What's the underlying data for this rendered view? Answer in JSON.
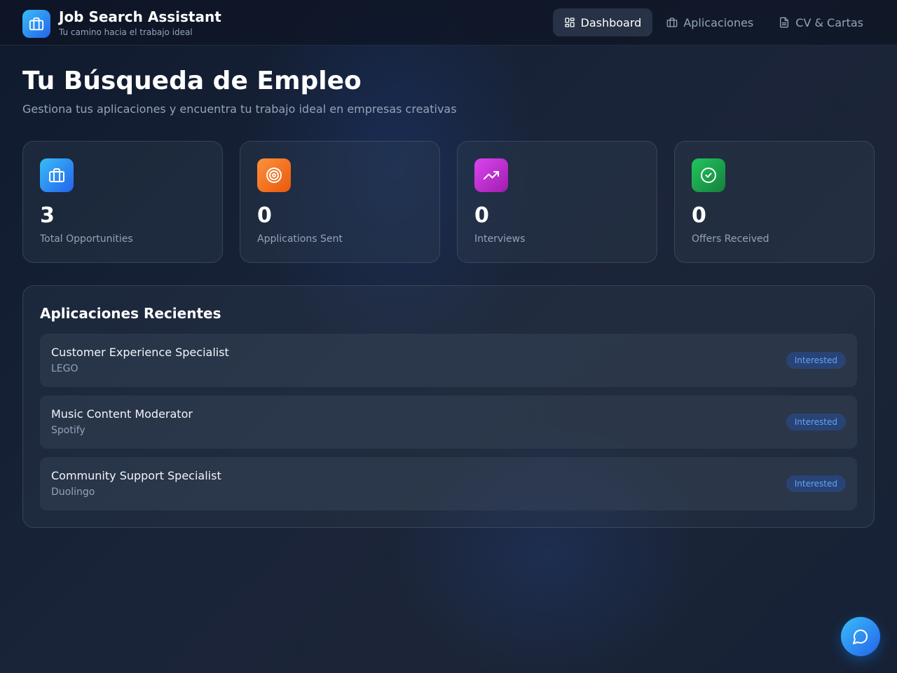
{
  "app": {
    "title": "Job Search Assistant",
    "subtitle": "Tu camino hacia el trabajo ideal",
    "logo_icon": "briefcase-icon"
  },
  "nav": {
    "items": [
      {
        "label": "Dashboard",
        "icon": "dashboard-grid-icon",
        "active": true
      },
      {
        "label": "Aplicaciones",
        "icon": "briefcase-icon",
        "active": false
      },
      {
        "label": "CV & Cartas",
        "icon": "document-icon",
        "active": false
      }
    ]
  },
  "header": {
    "title": "Tu Búsqueda de Empleo",
    "subtitle": "Gestiona tus aplicaciones y encuentra tu trabajo ideal en empresas creativas"
  },
  "stats": [
    {
      "value": "3",
      "label": "Total Opportunities",
      "icon": "briefcase-icon",
      "color": "#0ea5e9"
    },
    {
      "value": "0",
      "label": "Applications Sent",
      "icon": "target-icon",
      "color": "#f97316"
    },
    {
      "value": "0",
      "label": "Interviews",
      "icon": "trending-up-icon",
      "color": "#c026d3"
    },
    {
      "value": "0",
      "label": "Offers Received",
      "icon": "check-circle-icon",
      "color": "#16a34a"
    }
  ],
  "recent": {
    "title": "Aplicaciones Recientes",
    "items": [
      {
        "role": "Customer Experience Specialist",
        "company": "LEGO",
        "status": "Interested"
      },
      {
        "role": "Music Content Moderator",
        "company": "Spotify",
        "status": "Interested"
      },
      {
        "role": "Community Support Specialist",
        "company": "Duolingo",
        "status": "Interested"
      }
    ]
  },
  "chat": {
    "icon": "chat-bubble-icon"
  },
  "colors": {
    "accent": "#2563eb",
    "badge_text": "#60a5fa",
    "background": "#1a2438"
  }
}
